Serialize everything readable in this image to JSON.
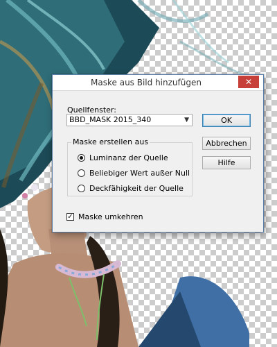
{
  "dialog": {
    "title": "Maske aus Bild hinzufügen",
    "close_glyph": "✕",
    "source_label": "Quellfenster:",
    "source_value": "BBD_MASK 2015_340",
    "group_title": "Maske erstellen aus",
    "options": [
      {
        "label": "Luminanz der Quelle",
        "checked": true
      },
      {
        "label": "Beliebiger Wert außer Null",
        "checked": false
      },
      {
        "label": "Deckfähigkeit der Quelle",
        "checked": false
      }
    ],
    "invert_label": "Maske umkehren",
    "invert_checked": true,
    "checkmark": "✓",
    "buttons": {
      "ok": "OK",
      "cancel": "Abbrechen",
      "help": "Hilfe"
    }
  },
  "colors": {
    "close_button": "#c7403a",
    "default_button_border": "#3c7fb1"
  }
}
